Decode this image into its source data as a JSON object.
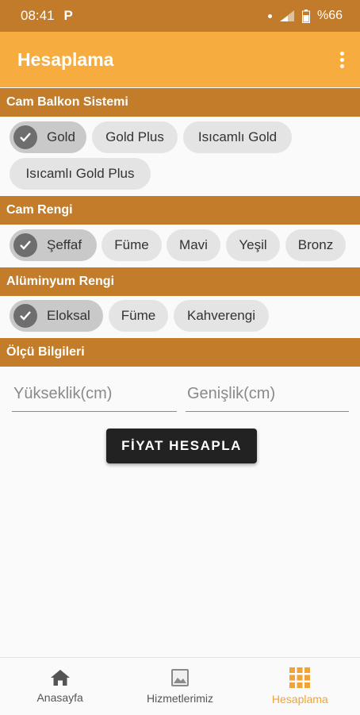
{
  "status_bar": {
    "time": "08:41",
    "app_letter": "P",
    "battery": "%66"
  },
  "app_bar": {
    "title": "Hesaplama"
  },
  "sections": {
    "balkon": {
      "header": "Cam Balkon Sistemi",
      "chips": [
        "Gold",
        "Gold Plus",
        "Isıcamlı Gold",
        "Isıcamlı Gold Plus"
      ],
      "selected": "Gold"
    },
    "renk": {
      "header": "Cam Rengi",
      "chips": [
        "Şeffaf",
        "Füme",
        "Mavi",
        "Yeşil",
        "Bronz"
      ],
      "selected": "Şeffaf"
    },
    "aluminyum": {
      "header": "Alüminyum Rengi",
      "chips": [
        "Eloksal",
        "Füme",
        "Kahverengi"
      ],
      "selected": "Eloksal"
    },
    "olcu": {
      "header": "Ölçü Bilgileri"
    }
  },
  "inputs": {
    "height_placeholder": "Yükseklik(cm)",
    "width_placeholder": "Genişlik(cm)"
  },
  "calculate_button": "FİYAT HESAPLA",
  "bottom_nav": [
    {
      "label": "Anasayfa",
      "icon": "home-icon"
    },
    {
      "label": "Hizmetlerimiz",
      "icon": "image-icon"
    },
    {
      "label": "Hesaplama",
      "icon": "grid-icon",
      "active": true
    }
  ],
  "colors": {
    "status_bar": "#c17b2b",
    "app_bar": "#f6ac3f",
    "section_header": "#c27c2a",
    "accent": "#f0a436"
  }
}
